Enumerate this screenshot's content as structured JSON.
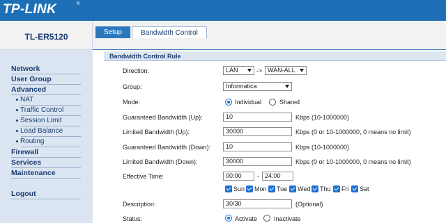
{
  "brand": {
    "logo_text": "TP-LINK",
    "reg_mark": "®",
    "model": "TL-ER5120"
  },
  "tabs": [
    {
      "label": "Setup",
      "active": false
    },
    {
      "label": "Bandwidth Control",
      "active": true
    }
  ],
  "sidebar": {
    "items": [
      {
        "label": "Network"
      },
      {
        "label": "User Group"
      },
      {
        "label": "Advanced"
      },
      {
        "label": "NAT"
      },
      {
        "label": "Traffic Control"
      },
      {
        "label": "Session Limit"
      },
      {
        "label": "Load Balance"
      },
      {
        "label": "Routing"
      },
      {
        "label": "Firewall"
      },
      {
        "label": "Services"
      },
      {
        "label": "Maintenance"
      },
      {
        "label": "Logout"
      }
    ]
  },
  "section": {
    "title": "Bandwidth Control Rule"
  },
  "form": {
    "direction": {
      "label": "Direction:",
      "from": "LAN",
      "arrow": "->",
      "to": "WAN-ALL"
    },
    "group": {
      "label": "Group:",
      "value": "Informatica"
    },
    "mode": {
      "label": "Mode:",
      "option1": "Individual",
      "option2": "Shared",
      "selected": "Individual"
    },
    "gbw_up": {
      "label": "Guaranteed Bandwidth (Up):",
      "value": "10",
      "note": "Kbps (10-1000000)"
    },
    "lbw_up": {
      "label": "Limited Bandwidth (Up):",
      "value": "30000",
      "note": "Kbps (0 or 10-1000000, 0 means no limit)"
    },
    "gbw_down": {
      "label": "Guaranteed Bandwidth (Down):",
      "value": "10",
      "note": "Kbps (10-1000000)"
    },
    "lbw_down": {
      "label": "Limited Bandwidth (Down):",
      "value": "30000",
      "note": "Kbps (0 or 10-1000000, 0 means no limit)"
    },
    "time": {
      "label": "Effective Time:",
      "start": "00:00",
      "dash": "-",
      "end": "24:00"
    },
    "days": [
      {
        "label": "Sun",
        "checked": true
      },
      {
        "label": "Mon",
        "checked": true
      },
      {
        "label": "Tue",
        "checked": true
      },
      {
        "label": "Wed",
        "checked": true
      },
      {
        "label": "Thu",
        "checked": true
      },
      {
        "label": "Fri",
        "checked": true
      },
      {
        "label": "Sat",
        "checked": true
      }
    ],
    "description": {
      "label": "Description:",
      "value": "30/30",
      "note": "(Optional)"
    },
    "status": {
      "label": "Status:",
      "option1": "Activate",
      "option2": "Inactivate",
      "selected": "Activate"
    }
  },
  "colors": {
    "header_blue": "#1d70b6",
    "sidebar_bg": "#dbe5f2",
    "nav_text": "#1b3d70",
    "checkbox_blue": "#1d6fd4"
  }
}
